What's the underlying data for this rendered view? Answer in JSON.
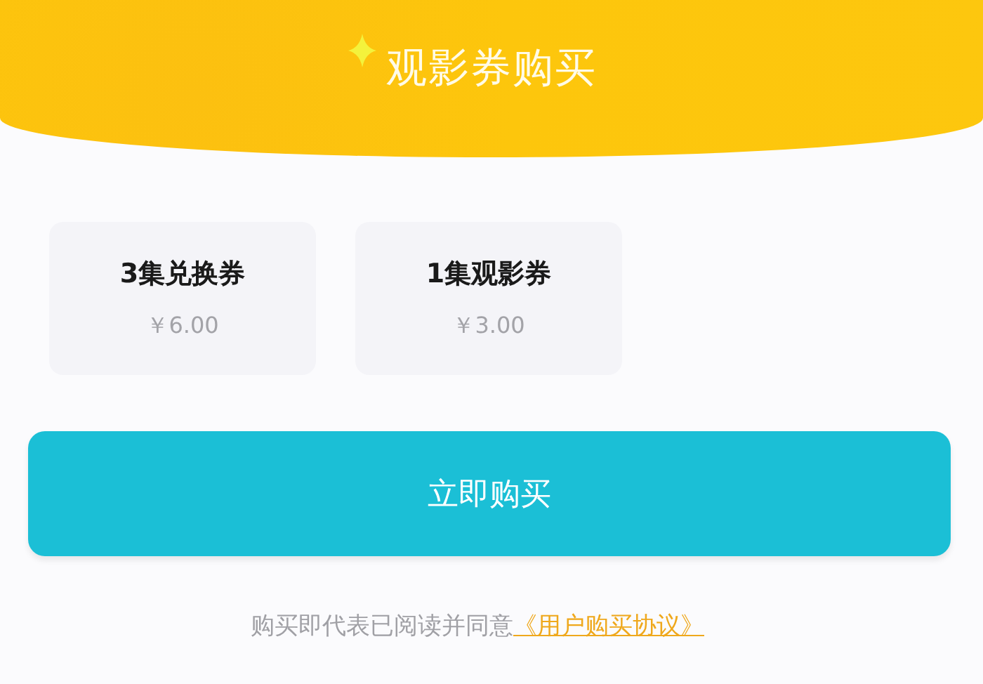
{
  "header": {
    "title": "观影券购买"
  },
  "tickets": [
    {
      "name": "3集兑换券",
      "price": "￥6.00"
    },
    {
      "name": "1集观影券",
      "price": "￥3.00"
    }
  ],
  "buy_button": "立即购买",
  "agreement": {
    "text": "购买即代表已阅读并同意",
    "link": "《用户购买协议》"
  }
}
